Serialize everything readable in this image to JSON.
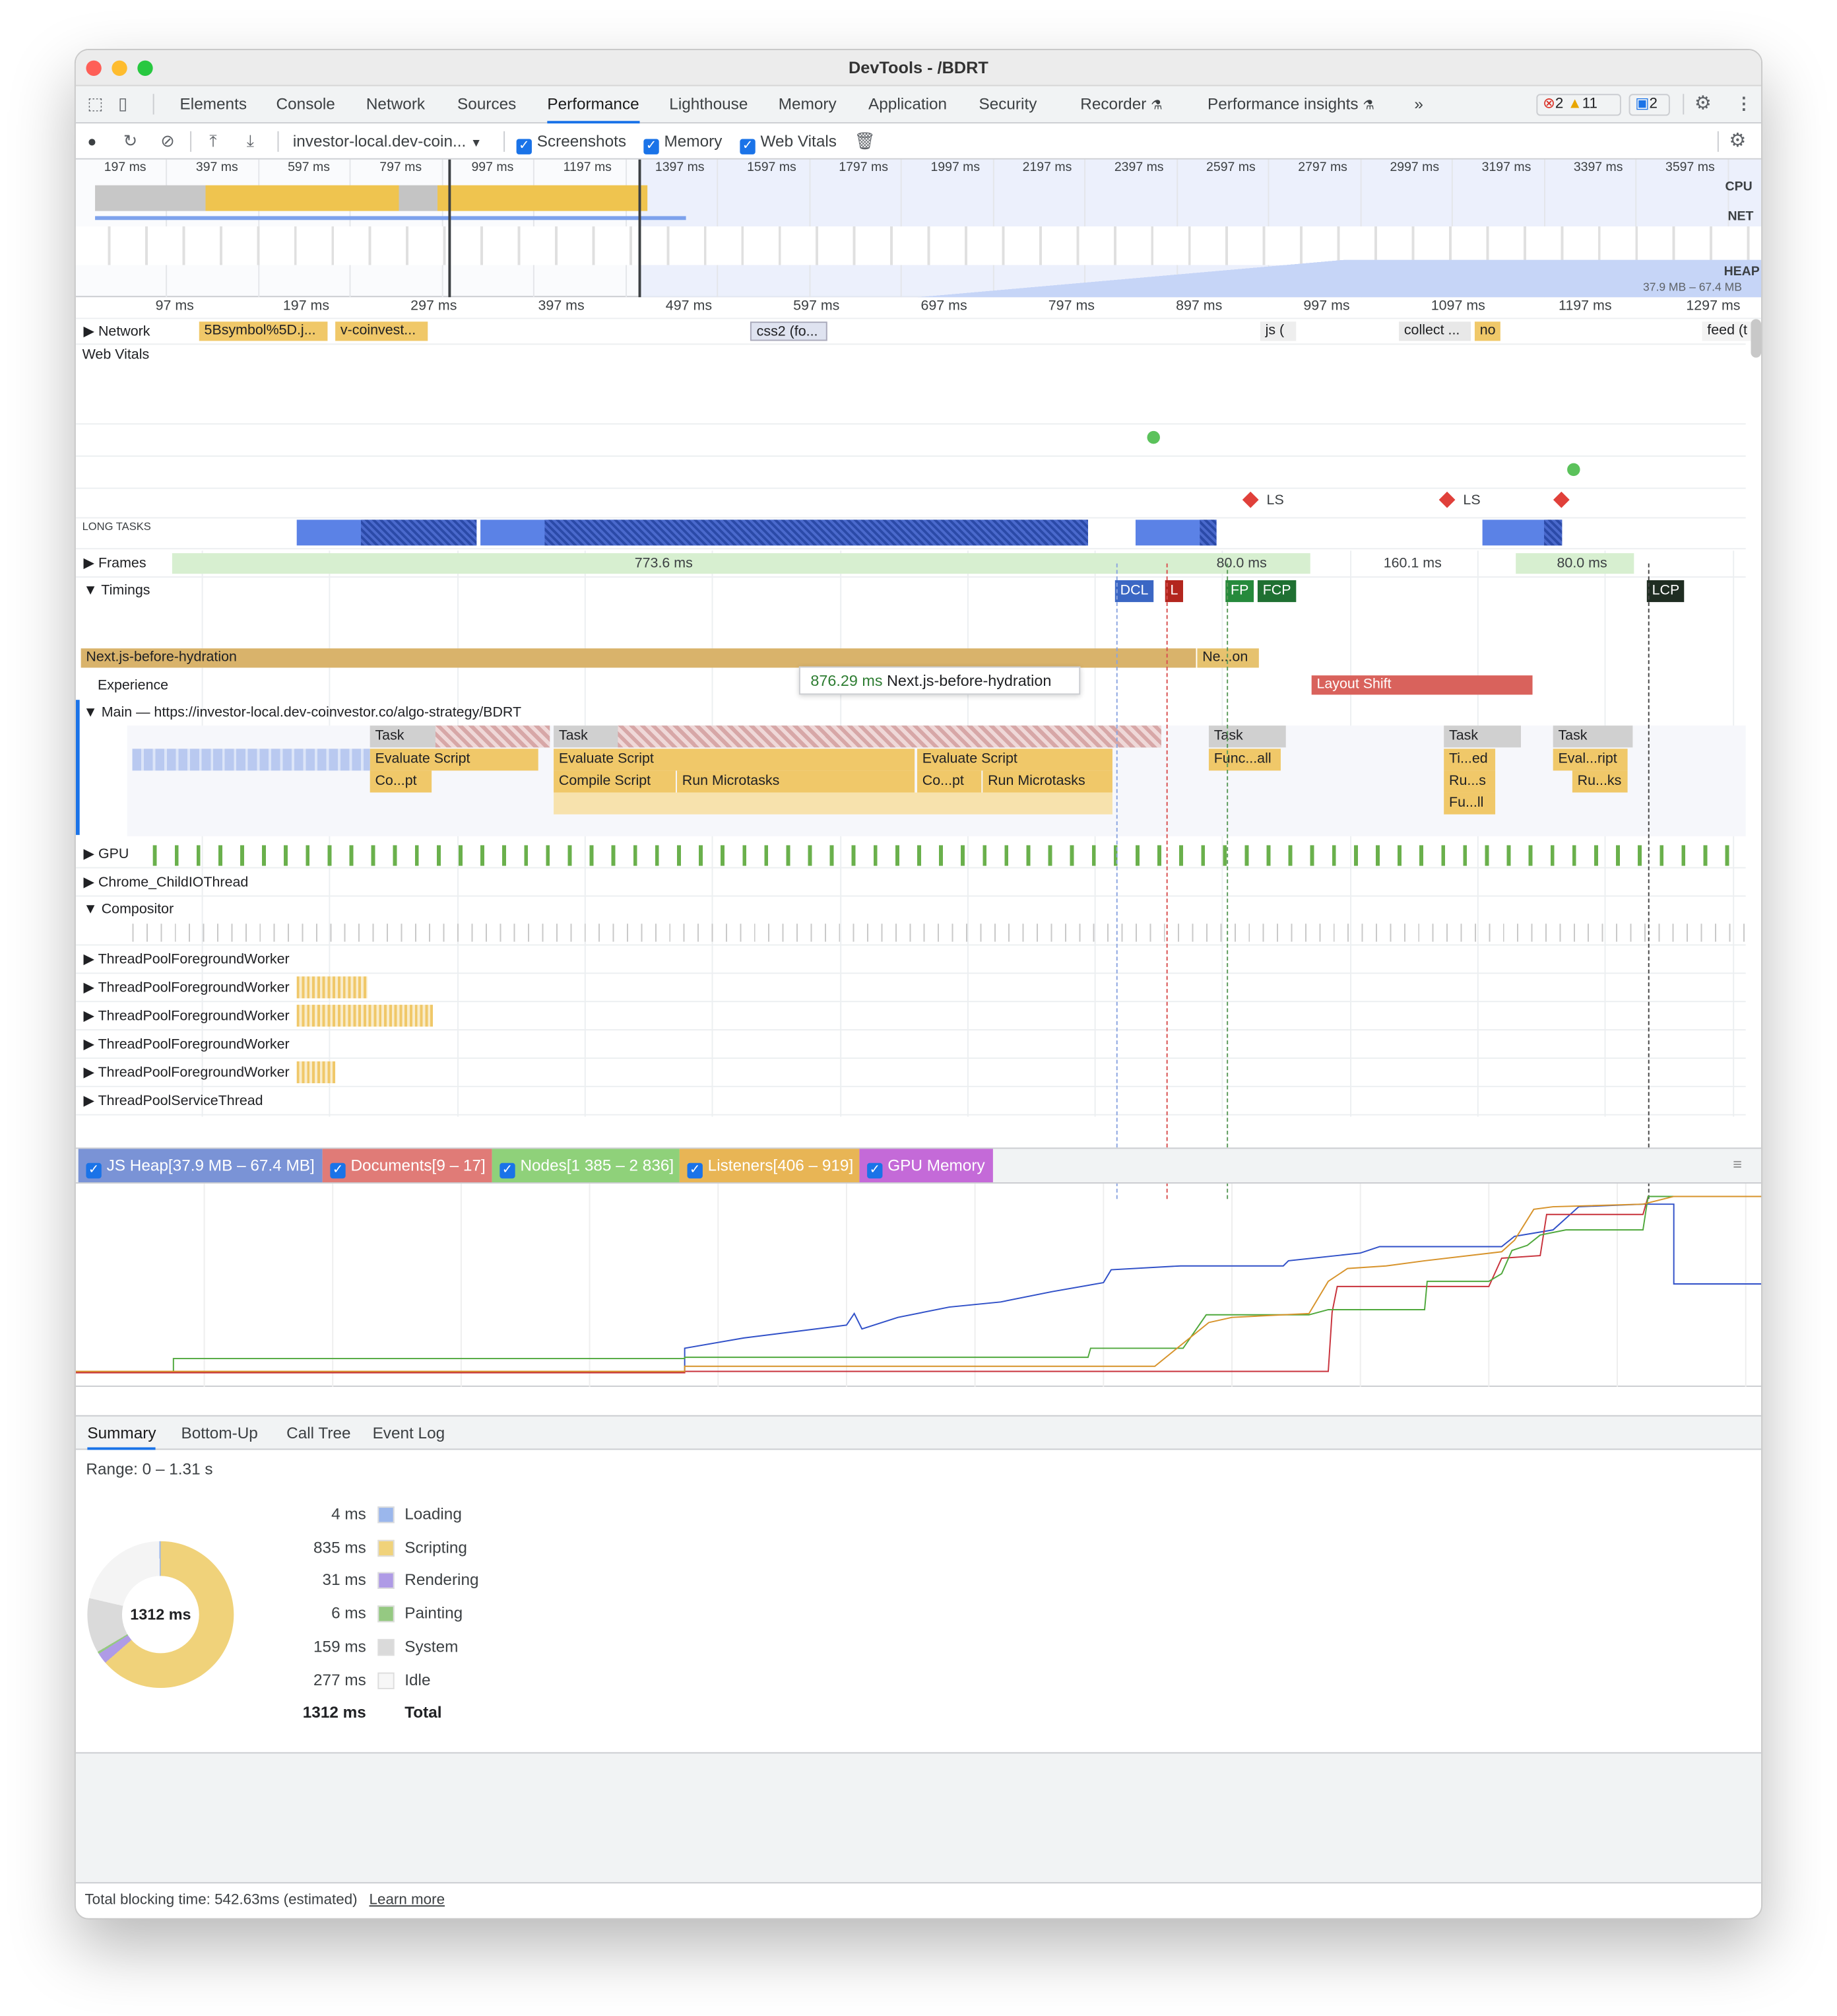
{
  "window": {
    "title": "DevTools - /BDRT"
  },
  "tabs": [
    "Elements",
    "Console",
    "Network",
    "Sources",
    "Performance",
    "Lighthouse",
    "Memory",
    "Application",
    "Security",
    "Recorder",
    "Performance insights"
  ],
  "active_tab": "Performance",
  "issues": {
    "errors": "2",
    "warnings": "11",
    "messages": "2"
  },
  "toolbar": {
    "url_select": "investor-local.dev-coin...",
    "screenshots": "Screenshots",
    "memory": "Memory",
    "web_vitals": "Web Vitals"
  },
  "overview": {
    "ticks": [
      "197 ms",
      "397 ms",
      "597 ms",
      "797 ms",
      "997 ms",
      "1197 ms",
      "1397 ms",
      "1597 ms",
      "1797 ms",
      "1997 ms",
      "2197 ms",
      "2397 ms",
      "2597 ms",
      "2797 ms",
      "2997 ms",
      "3197 ms",
      "3397 ms",
      "3597 ms"
    ],
    "cpu": "CPU",
    "net": "NET",
    "heap": "HEAP",
    "heap_range": "37.9 MB – 67.4 MB"
  },
  "ruler": [
    "97 ms",
    "197 ms",
    "297 ms",
    "397 ms",
    "497 ms",
    "597 ms",
    "697 ms",
    "797 ms",
    "897 ms",
    "997 ms",
    "1097 ms",
    "1197 ms",
    "1297 ms"
  ],
  "network": {
    "label": "Network",
    "requests": [
      "5Bsymbol%5D.j...",
      "v-coinvest...",
      "css2 (fo...",
      "js (",
      "collect ...",
      "no",
      "feed (t"
    ]
  },
  "web_vitals": {
    "label": "Web Vitals",
    "ls": [
      "LS",
      "LS"
    ]
  },
  "long_tasks": "LONG TASKS",
  "frames": {
    "label": "Frames",
    "values": [
      "773.6 ms",
      "80.0 ms",
      "160.1 ms",
      "80.0 ms"
    ]
  },
  "timings": {
    "label": "Timings",
    "markers": [
      "DCL",
      "L",
      "FP",
      "FCP",
      "LCP"
    ]
  },
  "nextjs": {
    "bar": "Next.js-before-hydration",
    "short": "Ne...on",
    "tooltip_time": "876.29 ms",
    "tooltip_text": "Next.js-before-hydration"
  },
  "experience": {
    "label": "Experience",
    "layout_shift": "Layout Shift"
  },
  "main": {
    "label": "Main — https://investor-local.dev-coinvestor.co/algo-strategy/BDRT",
    "bars": [
      "Task",
      "Evaluate Script",
      "Co...pt",
      "Task",
      "Evaluate Script",
      "Compile Script",
      "Run Microtasks",
      "Evaluate Script",
      "Co...pt",
      "Run Microtasks",
      "Task",
      "Func...all",
      "Task",
      "Ti...ed",
      "Ru...s",
      "Fu...ll",
      "Task",
      "Eval...ript",
      "Ru...ks"
    ]
  },
  "threads": [
    "GPU",
    "Chrome_ChildIOThread",
    "Compositor",
    "ThreadPoolForegroundWorker",
    "ThreadPoolForegroundWorker",
    "ThreadPoolForegroundWorker",
    "ThreadPoolForegroundWorker",
    "ThreadPoolForegroundWorker",
    "ThreadPoolServiceThread"
  ],
  "memory_legend": [
    {
      "label": "JS Heap[37.9 MB – 67.4 MB]",
      "color": "#7a93d6"
    },
    {
      "label": "Documents[9 – 17]",
      "color": "#e07b77"
    },
    {
      "label": "Nodes[1 385 – 2 836]",
      "color": "#8fd17a"
    },
    {
      "label": "Listeners[406 – 919]",
      "color": "#e8b555"
    },
    {
      "label": "GPU Memory",
      "color": "#c46ad8"
    }
  ],
  "bottom_tabs": [
    "Summary",
    "Bottom-Up",
    "Call Tree",
    "Event Log"
  ],
  "summary": {
    "range": "Range: 0 – 1.31 s",
    "donut_center": "1312 ms",
    "rows": [
      {
        "time": "4 ms",
        "label": "Loading",
        "color": "#9bb7ec"
      },
      {
        "time": "835 ms",
        "label": "Scripting",
        "color": "#f0d27a"
      },
      {
        "time": "31 ms",
        "label": "Rendering",
        "color": "#af9be6"
      },
      {
        "time": "6 ms",
        "label": "Painting",
        "color": "#95c982"
      },
      {
        "time": "159 ms",
        "label": "System",
        "color": "#dadada"
      },
      {
        "time": "277 ms",
        "label": "Idle",
        "color": "#f7f7f7"
      }
    ],
    "total_time": "1312 ms",
    "total_label": "Total"
  },
  "footer": {
    "text": "Total blocking time: 542.63ms (estimated)",
    "link": "Learn more"
  }
}
